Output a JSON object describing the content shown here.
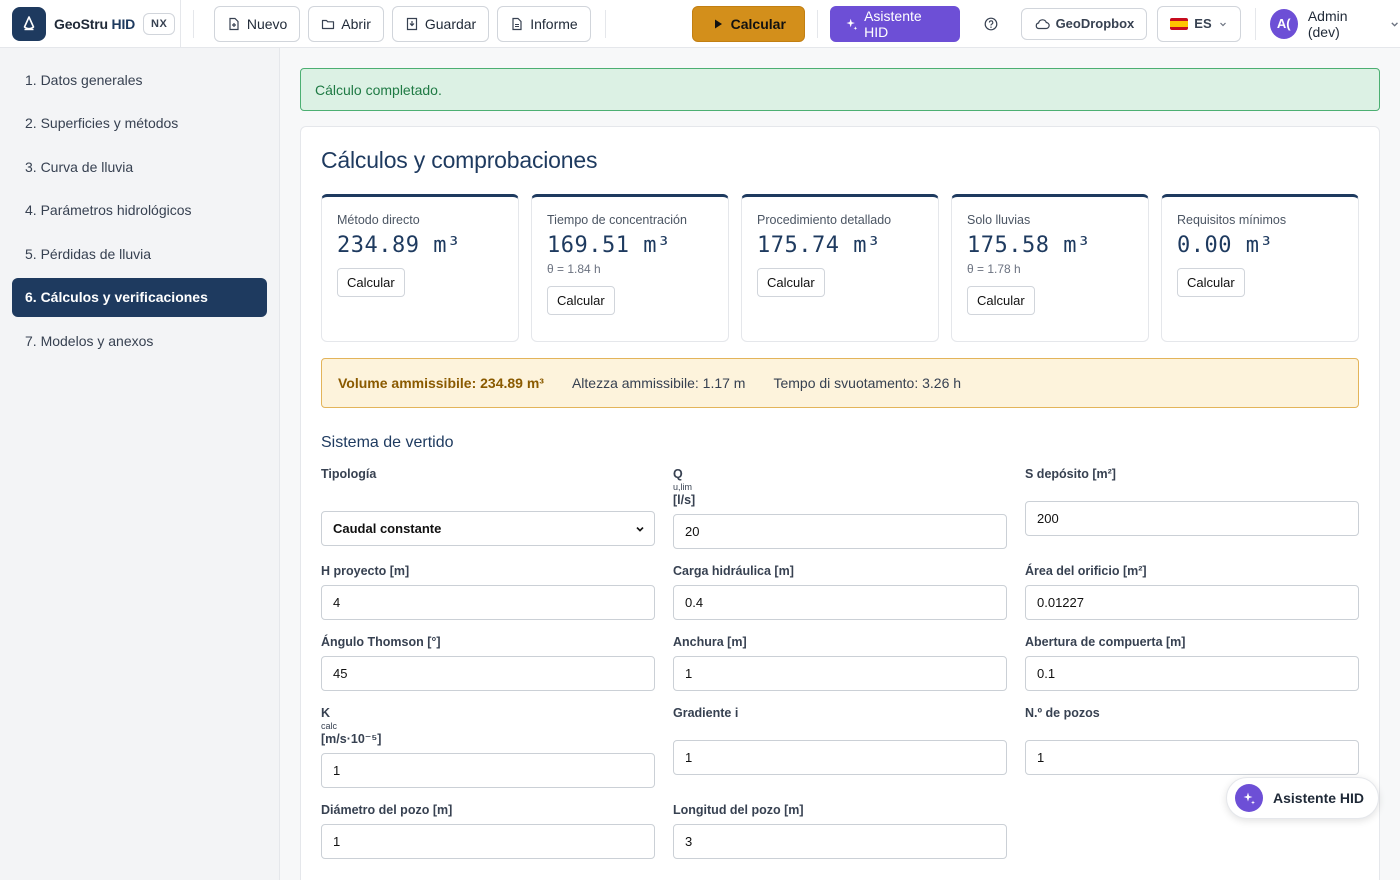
{
  "header": {
    "brand": "GeoStru",
    "brand_suffix": "HID",
    "badge": "NX",
    "toolbar": {
      "new_label": "Nuevo",
      "open_label": "Abrir",
      "save_label": "Guardar",
      "report_label": "Informe",
      "calc_label": "Calcular",
      "assistant_label": "Asistente HID"
    },
    "cloud_label": "GeoDropbox",
    "language": "ES",
    "user_initials": "A(",
    "user_name": "Admin (dev)"
  },
  "sidebar": {
    "items": [
      {
        "label": "1. Datos generales"
      },
      {
        "label": "2. Superficies y métodos"
      },
      {
        "label": "3. Curva de lluvia"
      },
      {
        "label": "4. Parámetros hidrológicos"
      },
      {
        "label": "5. Pérdidas de lluvia"
      },
      {
        "label": "6. Cálculos y verificaciones"
      },
      {
        "label": "7. Modelos y anexos"
      }
    ]
  },
  "main": {
    "alert": "Cálculo completado.",
    "title": "Cálculos y comprobaciones",
    "stats": [
      {
        "label": "Método directo",
        "value": "234.89 m³",
        "sub": "",
        "button": "Calcular"
      },
      {
        "label": "Tiempo de concentración",
        "value": "169.51 m³",
        "sub": "θ = 1.84 h",
        "button": "Calcular"
      },
      {
        "label": "Procedimiento detallado",
        "value": "175.74 m³",
        "sub": "",
        "button": "Calcular"
      },
      {
        "label": "Solo lluvias",
        "value": "175.58 m³",
        "sub": "θ = 1.78 h",
        "button": "Calcular"
      },
      {
        "label": "Requisitos mínimos",
        "value": "0.00 m³",
        "sub": "",
        "button": "Calcular"
      }
    ],
    "summary": {
      "volume": "Volume ammissibile: 234.89 m³",
      "height": "Altezza ammissibile: 1.17 m",
      "time": "Tempo di svuotamento: 3.26 h"
    },
    "section_title": "Sistema de vertido",
    "fields": {
      "tipologia": {
        "label": "Tipología",
        "value": "Caudal constante"
      },
      "q": {
        "label": "Q",
        "sub": "u,lim",
        "unit": "[l/s]",
        "value": "20"
      },
      "s_deposito": {
        "label": "S depósito [m²]",
        "value": "200"
      },
      "h_proyecto": {
        "label": "H proyecto [m]",
        "value": "4"
      },
      "carga": {
        "label": "Carga hidráulica [m]",
        "value": "0.4"
      },
      "area_orificio": {
        "label": "Área del orificio [m²]",
        "value": "0.01227"
      },
      "angulo": {
        "label": "Ángulo Thomson [°]",
        "value": "45"
      },
      "anchura": {
        "label": "Anchura [m]",
        "value": "1"
      },
      "abertura": {
        "label": "Abertura de compuerta [m]",
        "value": "0.1"
      },
      "k": {
        "label": "K",
        "sub": "calc",
        "unit": "[m/s·10⁻⁵]",
        "value": "1"
      },
      "gradiente": {
        "label": "Gradiente i",
        "value": "1"
      },
      "n_pozos": {
        "label": "N.º de pozos",
        "value": "1"
      },
      "diametro": {
        "label": "Diámetro del pozo [m]",
        "value": "1"
      },
      "longitud": {
        "label": "Longitud del pozo [m]",
        "value": "3"
      }
    }
  },
  "fab": {
    "label": "Asistente HID"
  },
  "colors": {
    "primary": "#1e3a5f",
    "accent_calc": "#d38f1b",
    "accent_ai": "#6d4fd6",
    "success": "#1f7a44",
    "warning_bg": "#fdf3dc"
  }
}
